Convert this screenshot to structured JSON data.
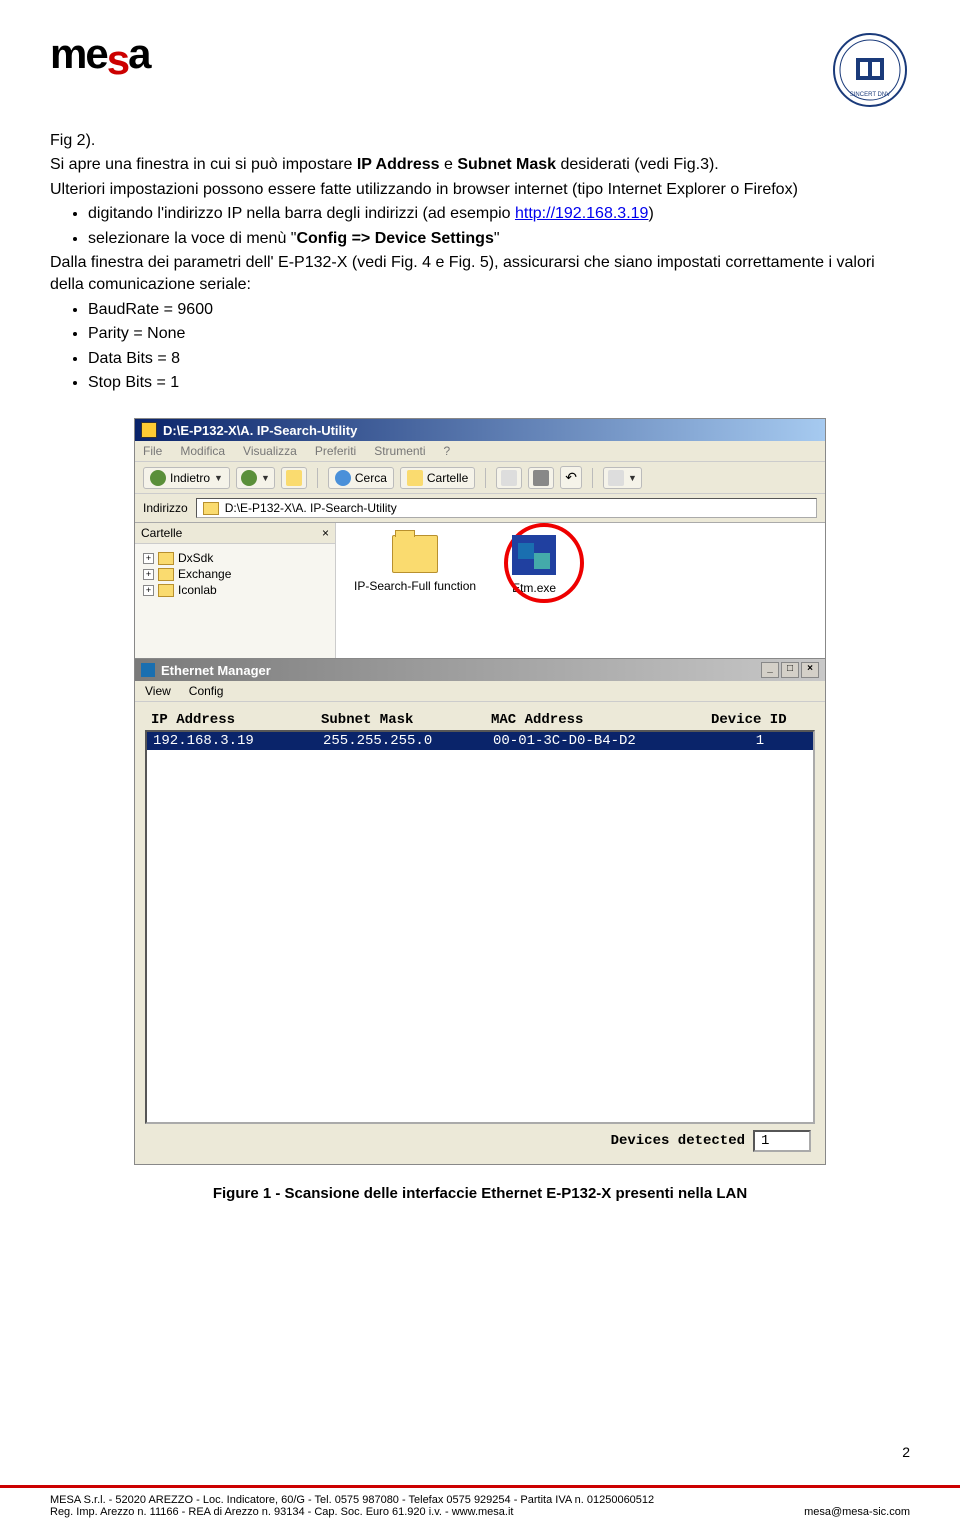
{
  "header": {
    "logo_text_1": "me",
    "logo_text_2": "s",
    "logo_text_3": "a"
  },
  "body": {
    "line1": "Fig 2).",
    "line2a": "Si apre una finestra in cui si può impostare ",
    "line2b": "IP Address",
    "line2c": " e ",
    "line2d": "Subnet Mask",
    "line2e": " desiderati (vedi Fig.3).",
    "para2": "Ulteriori impostazioni possono essere fatte utilizzando in browser internet (tipo Internet Explorer o Firefox)",
    "bullet1a": "digitando l'indirizzo IP nella barra degli indirizzi (ad esempio ",
    "bullet1_link": "http://192.168.3.19",
    "bullet1b": ")",
    "bullet2a": "selezionare la voce di menù \"",
    "bullet2b": "Config => Device Settings",
    "bullet2c": "\"",
    "para3": "Dalla finestra dei parametri dell' E-P132-X (vedi Fig. 4 e Fig. 5), assicurarsi che siano impostati correttamente i valori della comunicazione seriale:",
    "serial_items": [
      "BaudRate = 9600",
      "Parity = None",
      "Data Bits = 8",
      "Stop Bits = 1"
    ]
  },
  "explorer": {
    "title": "D:\\E-P132-X\\A. IP-Search-Utility",
    "menu": [
      "File",
      "Modifica",
      "Visualizza",
      "Preferiti",
      "Strumenti",
      "?"
    ],
    "toolbar": {
      "back": "Indietro",
      "search": "Cerca",
      "folders": "Cartelle"
    },
    "address_label": "Indirizzo",
    "address_value": "D:\\E-P132-X\\A. IP-Search-Utility",
    "folders_header": "Cartelle",
    "tree_items": [
      "DxSdk",
      "Exchange",
      "Iconlab"
    ],
    "file1": "IP-Search-Full function",
    "file2": "Etm.exe"
  },
  "etm": {
    "title": "Ethernet Manager",
    "menu": [
      "View",
      "Config"
    ],
    "columns": [
      "IP Address",
      "Subnet Mask",
      "MAC Address",
      "Device ID"
    ],
    "row": {
      "ip": "192.168.3.19",
      "mask": "255.255.255.0",
      "mac": "00-01-3C-D0-B4-D2",
      "dev": "1"
    },
    "footer_label": "Devices detected",
    "footer_count": "1"
  },
  "caption": "Figure 1 - Scansione delle interfaccie Ethernet E-P132-X presenti nella LAN",
  "page_number": "2",
  "footer": {
    "line1_left": "MESA S.r.l. - 52020 AREZZO - Loc. Indicatore, 60/G - Tel. 0575 987080 - Telefax 0575 929254 - Partita IVA n. 01250060512",
    "line2_left": "Reg. Imp. Arezzo n. 11166 - REA di Arezzo n. 93134 - Cap. Soc. Euro 61.920 i.v. - www.mesa.it",
    "line2_right": "mesa@mesa-sic.com"
  }
}
